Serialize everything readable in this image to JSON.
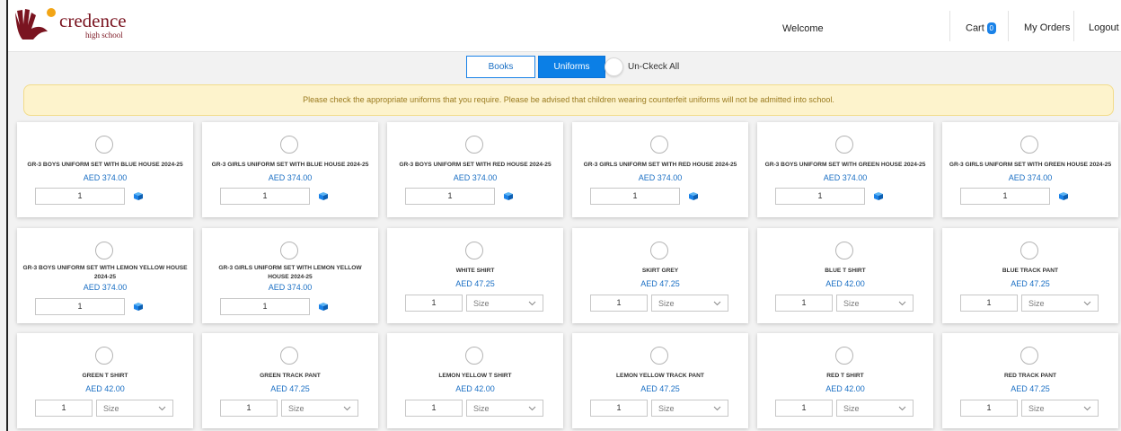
{
  "header": {
    "brand_name": "credence",
    "brand_sub": "high school",
    "welcome": "Welcome",
    "cart_label": "Cart",
    "cart_count": "0",
    "my_orders": "My Orders",
    "logout": "Logout"
  },
  "toolbar": {
    "books": "Books",
    "uniforms": "Uniforms",
    "uncheck_all": "Un-Ckeck All"
  },
  "notice": "Please check the appropriate uniforms that you require. Please be advised that children wearing counterfeit uniforms will not be admitted into school.",
  "colors": {
    "accent": "#0b7fe6",
    "price": "#1a6fc4",
    "brand": "#7a1420",
    "notice_bg": "#fdf3cc"
  },
  "products": [
    {
      "name": "GR-3 BOYS UNIFORM SET WITH BLUE HOUSE 2024-25",
      "price": "AED 374.00",
      "qty": "1",
      "kind": "set"
    },
    {
      "name": "GR-3 GIRLS UNIFORM SET WITH BLUE HOUSE 2024-25",
      "price": "AED 374.00",
      "qty": "1",
      "kind": "set"
    },
    {
      "name": "GR-3 BOYS UNIFORM SET WITH RED HOUSE 2024-25",
      "price": "AED 374.00",
      "qty": "1",
      "kind": "set"
    },
    {
      "name": "GR-3 GIRLS UNIFORM SET WITH RED HOUSE 2024-25",
      "price": "AED 374.00",
      "qty": "1",
      "kind": "set"
    },
    {
      "name": "GR-3 BOYS UNIFORM SET WITH GREEN HOUSE 2024-25",
      "price": "AED 374.00",
      "qty": "1",
      "kind": "set"
    },
    {
      "name": "GR-3 GIRLS UNIFORM SET WITH GREEN HOUSE 2024-25",
      "price": "AED 374.00",
      "qty": "1",
      "kind": "set"
    },
    {
      "name": "GR-3 BOYS UNIFORM SET WITH LEMON YELLOW HOUSE 2024-25",
      "price": "AED 374.00",
      "qty": "1",
      "kind": "set"
    },
    {
      "name": "GR-3  GIRLS UNIFORM SET WITH LEMON YELLOW HOUSE 2024-25",
      "price": "AED 374.00",
      "qty": "1",
      "kind": "set"
    },
    {
      "name": "WHITE SHIRT",
      "price": "AED 47.25",
      "qty": "1",
      "kind": "sized",
      "size": "Size"
    },
    {
      "name": "SKIRT GREY",
      "price": "AED 47.25",
      "qty": "1",
      "kind": "sized",
      "size": "Size"
    },
    {
      "name": "BLUE T SHIRT",
      "price": "AED 42.00",
      "qty": "1",
      "kind": "sized",
      "size": "Size"
    },
    {
      "name": "BLUE TRACK PANT",
      "price": "AED 47.25",
      "qty": "1",
      "kind": "sized",
      "size": "Size"
    },
    {
      "name": "GREEN T SHIRT",
      "price": "AED 42.00",
      "qty": "1",
      "kind": "sized",
      "size": "Size"
    },
    {
      "name": "GREEN TRACK PANT",
      "price": "AED 47.25",
      "qty": "1",
      "kind": "sized",
      "size": "Size"
    },
    {
      "name": "LEMON YELLOW T SHIRT",
      "price": "AED 42.00",
      "qty": "1",
      "kind": "sized",
      "size": "Size"
    },
    {
      "name": "LEMON YELLOW TRACK PANT",
      "price": "AED 47.25",
      "qty": "1",
      "kind": "sized",
      "size": "Size"
    },
    {
      "name": "RED T SHIRT",
      "price": "AED 42.00",
      "qty": "1",
      "kind": "sized",
      "size": "Size"
    },
    {
      "name": "RED TRACK PANT",
      "price": "AED 47.25",
      "qty": "1",
      "kind": "sized",
      "size": "Size"
    }
  ]
}
